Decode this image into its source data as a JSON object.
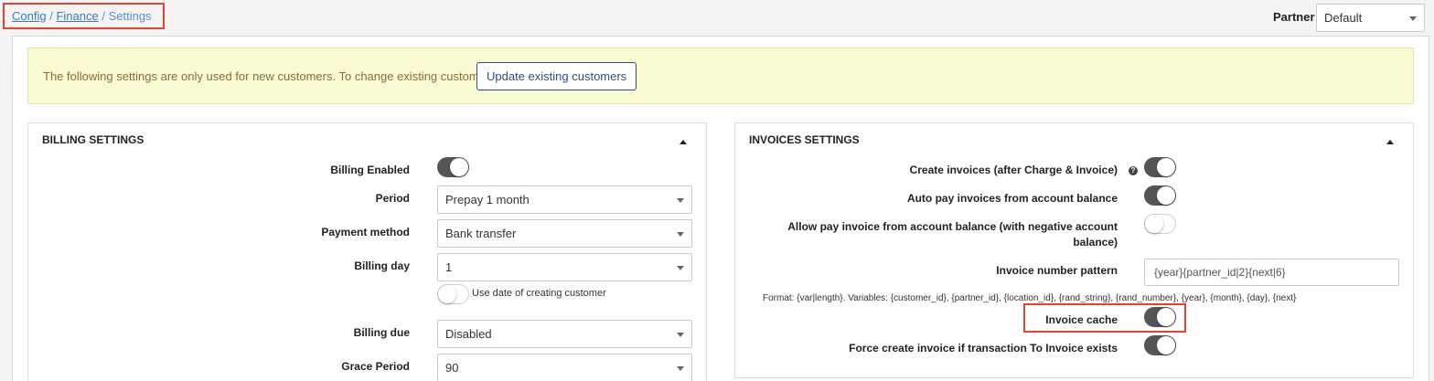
{
  "breadcrumb": {
    "items": [
      "Config",
      "Finance"
    ],
    "separator": "/",
    "current": "Settings"
  },
  "partner": {
    "label": "Partner",
    "value": "Default"
  },
  "notice": {
    "text": "The following settings are only used for new customers. To change existing customers:",
    "button": "Update existing customers"
  },
  "billing": {
    "title": "BILLING SETTINGS",
    "billing_enabled_label": "Billing Enabled",
    "billing_enabled": true,
    "period_label": "Period",
    "period_value": "Prepay 1 month",
    "payment_method_label": "Payment method",
    "payment_method_value": "Bank transfer",
    "billing_day_label": "Billing day",
    "billing_day_value": "1",
    "use_date_label": "Use date of creating customer",
    "use_date": false,
    "billing_due_label": "Billing due",
    "billing_due_value": "Disabled",
    "grace_period_label": "Grace Period",
    "grace_period_value": "90"
  },
  "invoices": {
    "title": "INVOICES SETTINGS",
    "create_invoices_label": "Create invoices (after Charge & Invoice)",
    "create_invoices": true,
    "auto_pay_label": "Auto pay invoices from account balance",
    "auto_pay": true,
    "allow_pay_label_1": "Allow pay invoice from account balance (with negative account",
    "allow_pay_label_2": "balance)",
    "allow_pay": false,
    "number_pattern_label": "Invoice number pattern",
    "number_pattern_value": "{year}{partner_id|2}{next|6}",
    "format_hint": "Format: {var|length}. Variables: {customer_id}, {partner_id}, {location_id}, {rand_string}, {rand_number}, {year}, {month}, {day}, {next}",
    "invoice_cache_label": "Invoice cache",
    "invoice_cache": true,
    "force_create_label": "Force create invoice if transaction To Invoice exists",
    "force_create": true
  },
  "icons": {
    "help": "?"
  },
  "colors": {
    "highlight": "#e8412c",
    "toggle_on": "#555555",
    "notice_bg": "#fafad2",
    "link": "#3c78c8"
  }
}
